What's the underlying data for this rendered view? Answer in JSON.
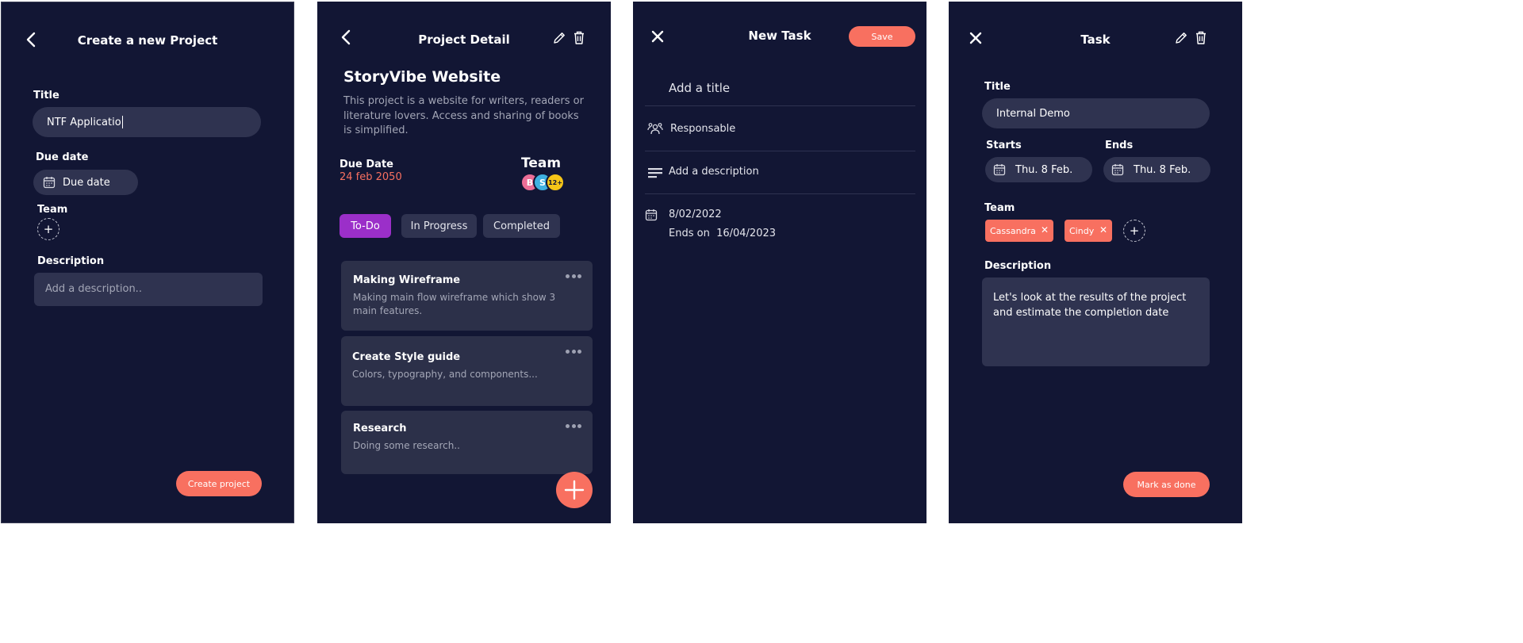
{
  "screen1": {
    "title": "Create a new Project",
    "title_label": "Title",
    "title_value": "NTF Applicatio",
    "due_label": "Due date",
    "due_placeholder": "Due date",
    "team_label": "Team",
    "add_symbol": "+",
    "description_label": "Description",
    "description_placeholder": "Add a description..",
    "create_button": "Create project"
  },
  "screen2": {
    "title": "Project Detail",
    "project_name": "StoryVibe Website",
    "project_description": "This project is a website for writers, readers or literature lovers. Access and sharing of books is simplified.",
    "due_label": "Due Date",
    "due_value": "24 feb 2050",
    "team_label": "Team",
    "avatars": [
      {
        "initial": "B",
        "color": "#ec6e97"
      },
      {
        "initial": "S",
        "color": "#3fb1e0"
      },
      {
        "initial": "12+",
        "color": "#f5c518"
      }
    ],
    "tabs": [
      {
        "label": "To-Do",
        "active": true
      },
      {
        "label": "In Progress",
        "active": false
      },
      {
        "label": "Completed",
        "active": false
      }
    ],
    "tasks": [
      {
        "title": "Making Wireframe",
        "description": "Making main flow wireframe which show 3 main features."
      },
      {
        "title": "Create Style guide",
        "description": "Colors, typography, and components..."
      },
      {
        "title": "Research",
        "description": "Doing some research.."
      }
    ],
    "fab_symbol": "+"
  },
  "screen3": {
    "title": "New Task",
    "save_button": "Save",
    "title_placeholder": "Add a title",
    "responsable": "Responsable",
    "description_placeholder": "Add a description",
    "start_date": "8/02/2022",
    "ends_label": "Ends on",
    "end_date": "16/04/2023"
  },
  "screen4": {
    "title": "Task",
    "title_label": "Title",
    "title_value": "Internal Demo",
    "starts_label": "Starts",
    "starts_value": "Thu. 8 Feb.",
    "ends_label": "Ends",
    "ends_value": "Thu. 8 Feb.",
    "team_label": "Team",
    "members": [
      {
        "name": "Cassandra"
      },
      {
        "name": "Cindy"
      }
    ],
    "remove_symbol": "✕",
    "add_symbol": "+",
    "description_label": "Description",
    "description_value": "Let's look at the results of the project and estimate the completion date",
    "mark_done_button": "Mark as done"
  },
  "colors": {
    "background": "#121634",
    "surface": "#2f3350",
    "accent": "#f87060",
    "active_tab": "#9b2fc9",
    "muted_text": "#a3a6b6"
  },
  "icons": [
    "back-arrow-icon",
    "close-icon",
    "pencil-icon",
    "trash-icon",
    "calendar-icon",
    "people-icon",
    "text-lines-icon",
    "plus-icon",
    "more-dots-icon"
  ]
}
